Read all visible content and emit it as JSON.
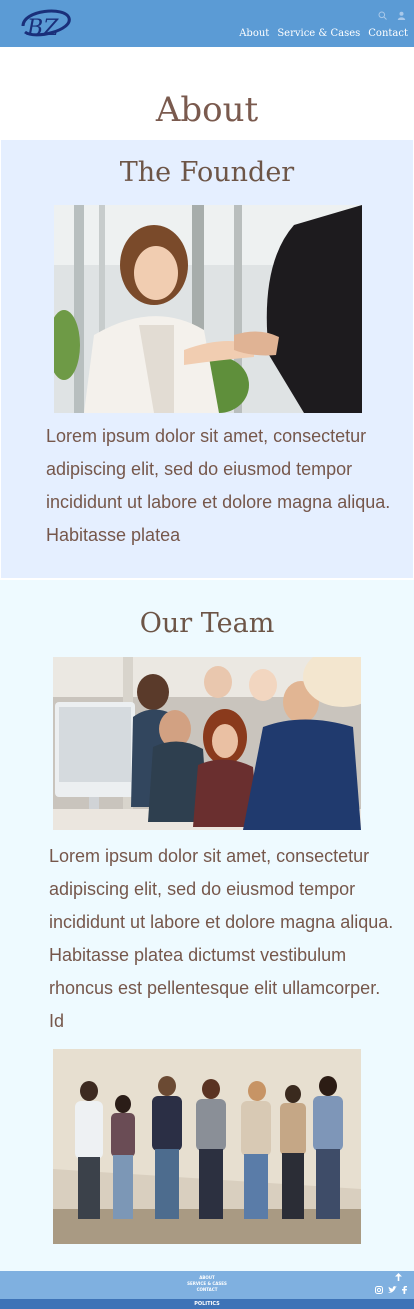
{
  "header": {
    "logo_text": "BZ",
    "nav": [
      "About",
      "Service & Cases",
      "Contact"
    ],
    "icons": [
      "search-icon",
      "user-icon"
    ]
  },
  "page": {
    "title": "About"
  },
  "founder": {
    "title": "The Founder",
    "text": "Lorem ipsum dolor sit amet, consectetur adipiscing elit, sed do eiusmod tempor incididunt ut labore et dolore magna aliqua. Habitasse platea"
  },
  "team": {
    "title": "Our Team",
    "text": "Lorem ipsum dolor sit amet, consectetur adipiscing elit, sed do eiusmod tempor incididunt ut labore et dolore magna aliqua. Habitasse platea dictumst vestibulum rhoncus est pellentesque elit ullamcorper. Id"
  },
  "footer": {
    "links": [
      "ABOUT",
      "SERVICE & CASES",
      "CONTACT"
    ],
    "bottom": "POLITICS",
    "icons": [
      "arrow-up-icon",
      "instagram-icon",
      "twitter-icon",
      "facebook-icon"
    ]
  },
  "colors": {
    "header": "#5b9bd5",
    "founder_bg": "#e5efff",
    "team_bg": "#eefaff",
    "heading": "#7a5a4e",
    "footer": "#7fb0e0",
    "footer_bottom": "#3e73b7"
  }
}
